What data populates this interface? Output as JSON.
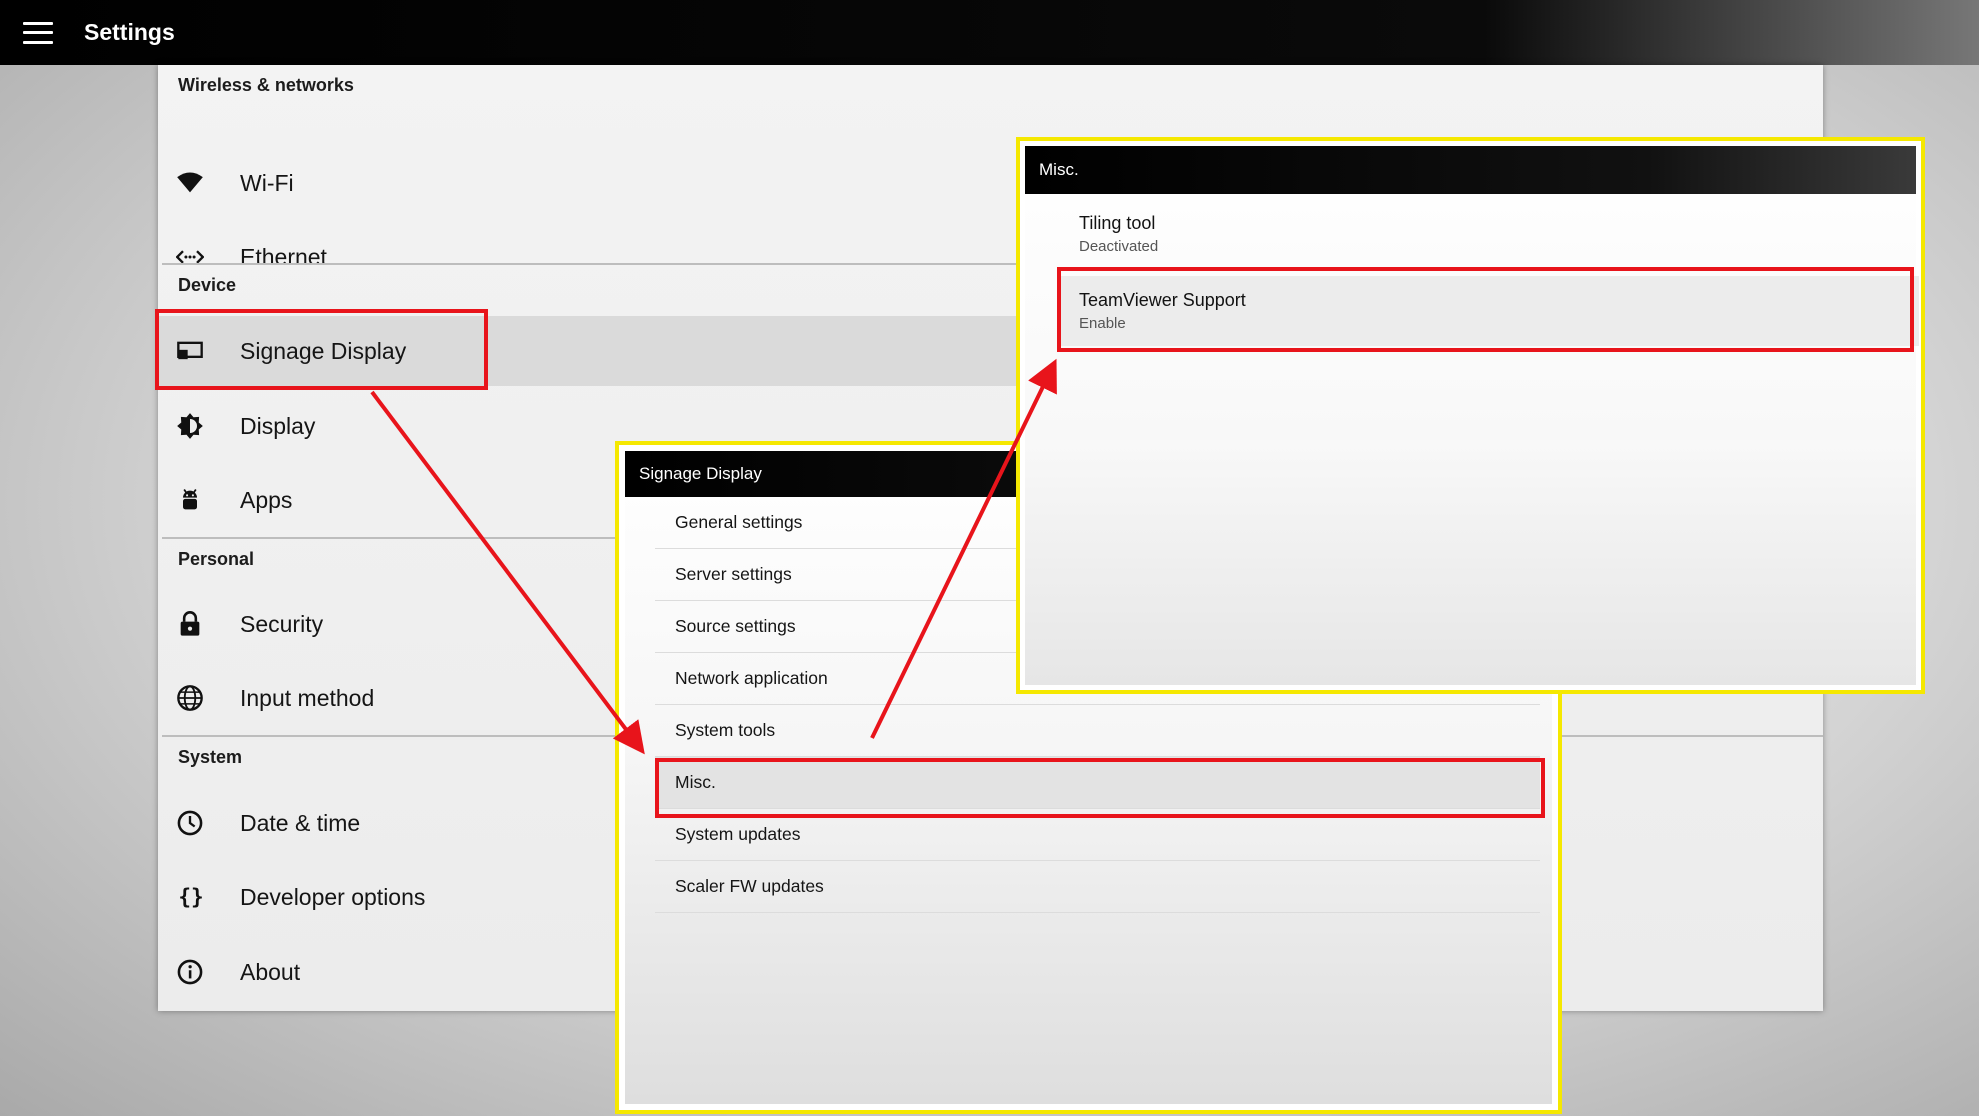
{
  "app_bar": {
    "title": "Settings",
    "menu_icon": "hamburger-menu-icon",
    "background": "#000000"
  },
  "settings": {
    "sections": [
      {
        "header": "Wireless & networks",
        "items": [
          {
            "label": "Wi-Fi",
            "icon": "wifi-icon"
          },
          {
            "label": "Ethernet",
            "icon": "ethernet-icon"
          }
        ]
      },
      {
        "header": "Device",
        "items": [
          {
            "label": "Signage Display",
            "icon": "signage-display-icon",
            "selected": true
          },
          {
            "label": "Display",
            "icon": "brightness-icon"
          },
          {
            "label": "Apps",
            "icon": "android-icon"
          }
        ]
      },
      {
        "header": "Personal",
        "items": [
          {
            "label": "Security",
            "icon": "lock-icon"
          },
          {
            "label": "Input method",
            "icon": "globe-icon"
          }
        ]
      },
      {
        "header": "System",
        "items": [
          {
            "label": "Date & time",
            "icon": "clock-icon"
          },
          {
            "label": "Developer options",
            "icon": "braces-icon"
          },
          {
            "label": "About",
            "icon": "info-icon"
          }
        ]
      }
    ]
  },
  "signage_window": {
    "title": "Signage Display",
    "items": [
      "General settings",
      "Server settings",
      "Source settings",
      "Network application",
      "System tools",
      "Misc.",
      "System updates",
      "Scaler FW updates"
    ],
    "highlighted": "Misc."
  },
  "misc_window": {
    "title": "Misc.",
    "items": [
      {
        "title": "Tiling tool",
        "subtitle": "Deactivated"
      },
      {
        "title": "TeamViewer Support",
        "subtitle": "Enable"
      }
    ],
    "highlighted": "TeamViewer Support"
  },
  "colors": {
    "highlight_red": "#e8141b",
    "window_frame_yellow": "#f5e800",
    "title_bar": "#000000"
  }
}
